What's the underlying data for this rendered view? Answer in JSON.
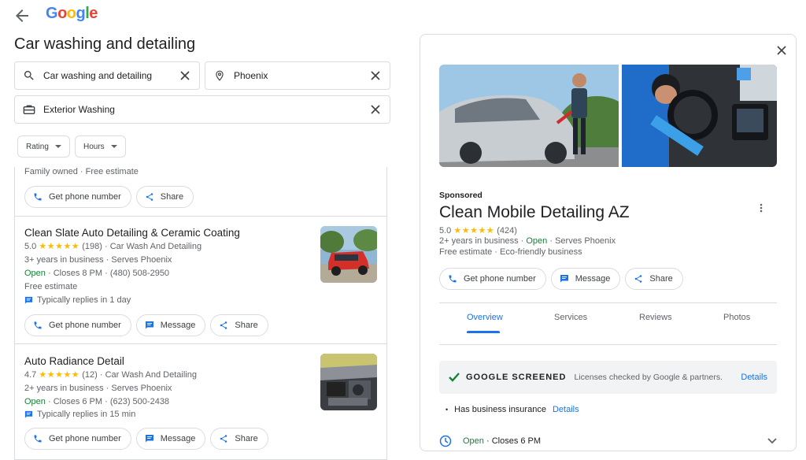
{
  "header": {
    "logo": [
      "G",
      "o",
      "o",
      "g",
      "l",
      "e"
    ],
    "logo_colors": [
      "#4285f4",
      "#ea4335",
      "#fbbc04",
      "#4285f4",
      "#34a853",
      "#ea4335"
    ],
    "title": "Car washing and detailing"
  },
  "search": {
    "service_value": "Car washing and detailing",
    "location_value": "Phoenix",
    "filter_value": "Exterior Washing"
  },
  "filters": {
    "rating": "Rating",
    "hours": "Hours"
  },
  "list": {
    "partial": {
      "meta": "Family owned · Free estimate",
      "phone_btn": "Get phone number",
      "share_btn": "Share"
    },
    "items": [
      {
        "name": "Clean Slate Auto Detailing & Ceramic Coating",
        "rating": "5.0",
        "stars": "★★★★★",
        "count_cat": "(198) · Car Wash And Detailing",
        "years": "3+ years in business · Serves Phoenix",
        "open": "Open",
        "hours_phone": " · Closes 8 PM · (480) 508-2950",
        "extra": "Free estimate",
        "reply": "Typically replies in 1 day",
        "phone_btn": "Get phone number",
        "message_btn": "Message",
        "share_btn": "Share"
      },
      {
        "name": "Auto Radiance Detail",
        "rating": "4.7",
        "stars": "★★★★★",
        "count_cat": "(12) · Car Wash And Detailing",
        "years": "2+ years in business · Serves Phoenix",
        "open": "Open",
        "hours_phone": " · Closes 6 PM · (623) 500-2438",
        "reply": "Typically replies in 15 min",
        "phone_btn": "Get phone number",
        "message_btn": "Message",
        "share_btn": "Share"
      }
    ]
  },
  "detail": {
    "sponsored": "Sponsored",
    "name": "Clean Mobile Detailing AZ",
    "rating": "5.0",
    "stars": "★★★★★",
    "count": "(424)",
    "years": "2+ years in business · ",
    "open": "Open",
    "serves": " · Serves Phoenix",
    "features": "Free estimate · Eco-friendly business",
    "phone_btn": "Get phone number",
    "message_btn": "Message",
    "share_btn": "Share",
    "tabs": [
      "Overview",
      "Services",
      "Reviews",
      "Photos"
    ],
    "screened_label": "GOOGLE SCREENED",
    "screened_desc": "Licenses checked by Google & partners.",
    "screened_link": "Details",
    "insurance": "Has business insurance",
    "insurance_link": "Details",
    "hours_open": "Open",
    "hours_close": " · Closes 6 PM"
  },
  "colors": {
    "accent": "#1a73e8",
    "open": "#188038",
    "star": "#fbbc04"
  }
}
